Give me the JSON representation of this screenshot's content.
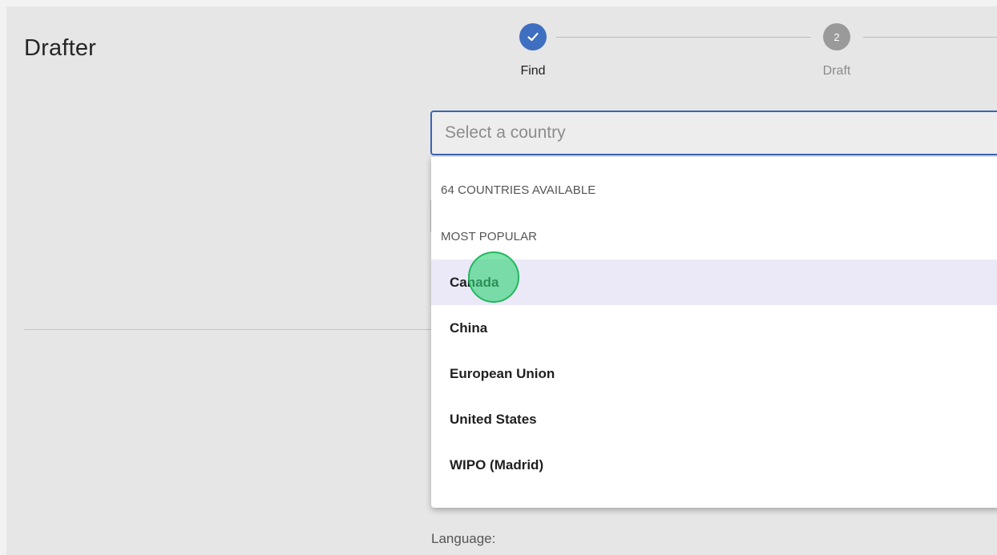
{
  "app": {
    "title": "Drafter"
  },
  "stepper": {
    "steps": [
      {
        "label": "Find",
        "status": "complete",
        "icon": "check-icon"
      },
      {
        "label": "Draft",
        "status": "pending",
        "number": "2"
      }
    ]
  },
  "search": {
    "placeholder": "Select a country",
    "value": ""
  },
  "dropdown": {
    "count_header": "64 COUNTRIES AVAILABLE",
    "group_header": "MOST POPULAR",
    "items": [
      {
        "label": "Canada",
        "highlighted": true
      },
      {
        "label": "China"
      },
      {
        "label": "European Union"
      },
      {
        "label": "United States"
      },
      {
        "label": "WIPO (Madrid)"
      }
    ]
  },
  "form": {
    "language_label": "Language:"
  },
  "colors": {
    "accent": "#3f6fc0",
    "highlight": "#ebe8f8",
    "click_marker": "#34d378"
  }
}
